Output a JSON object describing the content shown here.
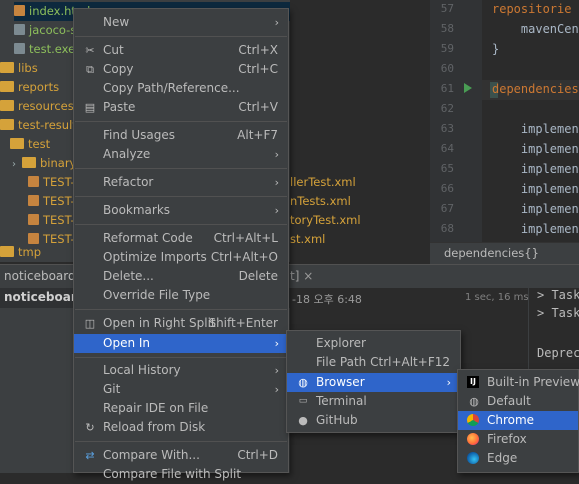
{
  "project_tree": {
    "items": [
      {
        "label": "index.html",
        "kind": "html"
      },
      {
        "label": "jacoco-se",
        "kind": "gray"
      },
      {
        "label": "test.exec",
        "kind": "gray"
      },
      {
        "label": "libs",
        "kind": "folder"
      },
      {
        "label": "reports",
        "kind": "folder"
      },
      {
        "label": "resources",
        "kind": "folder"
      },
      {
        "label": "test-results",
        "kind": "folder"
      },
      {
        "label": "test",
        "kind": "folder"
      },
      {
        "label": "binary",
        "kind": "folder"
      },
      {
        "label": "TEST-",
        "kind": "xml"
      },
      {
        "label": "TEST-",
        "kind": "xml"
      },
      {
        "label": "TEST-",
        "kind": "xml"
      },
      {
        "label": "TEST-",
        "kind": "xml"
      },
      {
        "label": "tmp",
        "kind": "folder"
      }
    ],
    "file_tails": [
      "llerTest.xml",
      "nTests.xml",
      "toryTest.xml",
      "st.xml"
    ]
  },
  "editor": {
    "line_numbers": [
      "57",
      "58",
      "59",
      "60",
      "61",
      "62",
      "63",
      "64",
      "65",
      "66",
      "67",
      "68"
    ],
    "lines": [
      "repositorie",
      "    mavenCen",
      "}",
      "",
      "dependencies",
      "",
      "    implemen",
      "    implemen",
      "    implemen",
      "    implemen",
      "    implemen",
      "    implemen"
    ],
    "breadcrumb": "dependencies{}"
  },
  "run_panel": {
    "tab_label": "noticeboard [j",
    "tab_close": "t] ×",
    "tree_item": "noticeboard",
    "timestamp": "-18 오후 6:48",
    "duration": "1 sec, 16 ms",
    "console_lines": [
      "> Task",
      "> Task",
      "",
      "Deprec"
    ]
  },
  "context_menu": {
    "items": [
      {
        "label": "New",
        "shortcut": "",
        "submenu": true,
        "icon": ""
      },
      {
        "sep": true
      },
      {
        "label": "Cut",
        "shortcut": "Ctrl+X",
        "icon": "scissors"
      },
      {
        "label": "Copy",
        "shortcut": "Ctrl+C",
        "icon": "copy"
      },
      {
        "label": "Copy Path/Reference...",
        "shortcut": ""
      },
      {
        "label": "Paste",
        "shortcut": "Ctrl+V",
        "icon": "paste"
      },
      {
        "sep": true
      },
      {
        "label": "Find Usages",
        "shortcut": "Alt+F7"
      },
      {
        "label": "Analyze",
        "shortcut": "",
        "submenu": true
      },
      {
        "sep": true
      },
      {
        "label": "Refactor",
        "shortcut": "",
        "submenu": true
      },
      {
        "sep": true
      },
      {
        "label": "Bookmarks",
        "shortcut": "",
        "submenu": true
      },
      {
        "sep": true
      },
      {
        "label": "Reformat Code",
        "shortcut": "Ctrl+Alt+L"
      },
      {
        "label": "Optimize Imports",
        "shortcut": "Ctrl+Alt+O"
      },
      {
        "label": "Delete...",
        "shortcut": "Delete"
      },
      {
        "label": "Override File Type",
        "shortcut": ""
      },
      {
        "sep": true
      },
      {
        "label": "Open in Right Split",
        "shortcut": "Shift+Enter",
        "icon": "split"
      },
      {
        "label": "Open In",
        "shortcut": "",
        "submenu": true,
        "selected": true
      },
      {
        "sep": true
      },
      {
        "label": "Local History",
        "shortcut": "",
        "submenu": true
      },
      {
        "label": "Git",
        "shortcut": "",
        "submenu": true
      },
      {
        "label": "Repair IDE on File",
        "shortcut": ""
      },
      {
        "label": "Reload from Disk",
        "shortcut": "",
        "icon": "reload"
      },
      {
        "sep": true
      },
      {
        "label": "Compare With...",
        "shortcut": "Ctrl+D",
        "icon": "compare"
      },
      {
        "label": "Compare File with Split",
        "shortcut": ""
      }
    ]
  },
  "open_in_menu": {
    "items": [
      {
        "label": "Explorer",
        "shortcut": ""
      },
      {
        "label": "File Path",
        "shortcut": "Ctrl+Alt+F12"
      },
      {
        "label": "Browser",
        "shortcut": "",
        "submenu": true,
        "selected": true,
        "icon": "globe"
      },
      {
        "label": "Terminal",
        "shortcut": "",
        "icon": "terminal"
      },
      {
        "label": "GitHub",
        "shortcut": "",
        "icon": "github"
      }
    ]
  },
  "browser_menu": {
    "items": [
      {
        "label": "Built-in Preview",
        "icon": "builtin"
      },
      {
        "label": "Default",
        "icon": "globe"
      },
      {
        "label": "Chrome",
        "icon": "chrome",
        "selected": true
      },
      {
        "label": "Firefox",
        "icon": "firefox"
      },
      {
        "label": "Edge",
        "icon": "edge"
      }
    ]
  },
  "colors": {
    "selection": "#2f65ca",
    "menu_bg": "#3c3f41",
    "editor_bg": "#2b2b2b",
    "keyword": "#cc7832",
    "folder": "#d5a23a"
  }
}
